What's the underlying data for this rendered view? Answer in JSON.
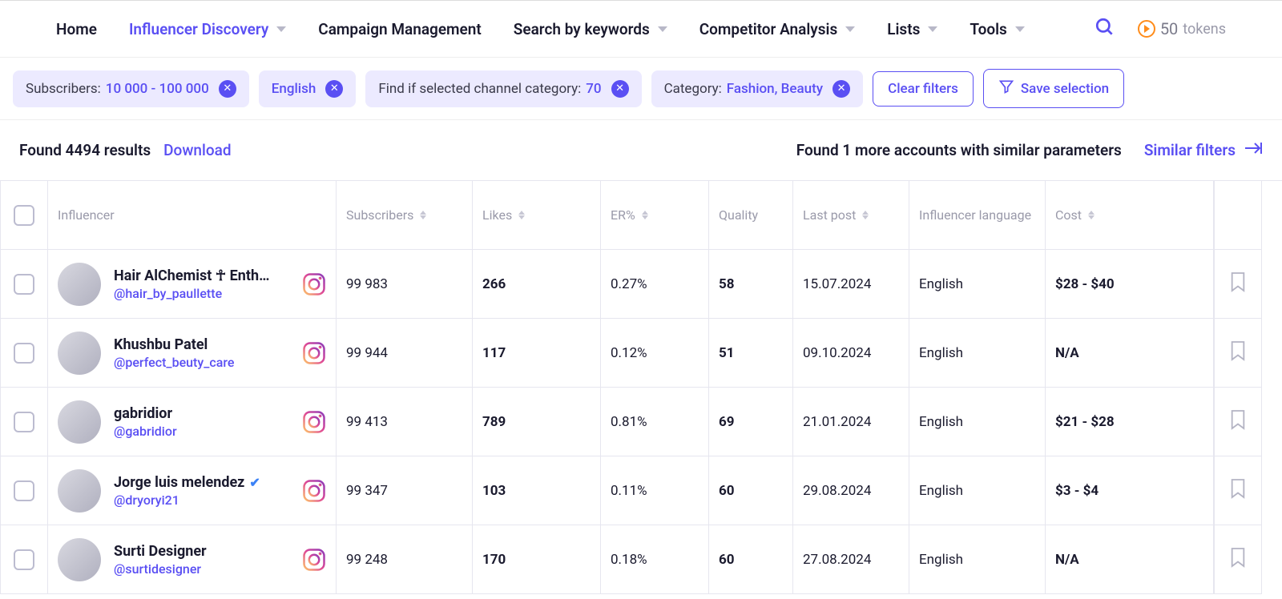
{
  "nav": {
    "home": "Home",
    "discovery": "Influencer Discovery",
    "campaign": "Campaign Management",
    "keywords": "Search by keywords",
    "competitor": "Competitor Analysis",
    "lists": "Lists",
    "tools": "Tools",
    "tokens_count": "50",
    "tokens_label": "tokens"
  },
  "filters": {
    "subscribers_label": "Subscribers:",
    "subscribers_value": "10 000 - 100 000",
    "lang_value": "English",
    "category_find_label": "Find if selected channel category:",
    "category_find_value": "70",
    "category_label": "Category:",
    "category_value": "Fashion, Beauty",
    "clear": "Clear filters",
    "save": "Save selection"
  },
  "meta": {
    "found_label": "Found 4494 results",
    "download": "Download",
    "more_label": "Found 1 more accounts with similar parameters",
    "similar": "Similar filters"
  },
  "columns": {
    "influencer": "Influencer",
    "subscribers": "Subscribers",
    "likes": "Likes",
    "er": "ER%",
    "quality": "Quality",
    "last_post": "Last post",
    "language": "Influencer language",
    "cost": "Cost"
  },
  "rows": [
    {
      "name": "Hair AlChemist ☥ Enth…",
      "handle": "@hair_by_paullette",
      "verified": false,
      "subscribers": "99 983",
      "likes": "266",
      "er": "0.27%",
      "quality": "58",
      "last_post": "15.07.2024",
      "language": "English",
      "cost": "$28 - $40"
    },
    {
      "name": "Khushbu Patel",
      "handle": "@perfect_beuty_care",
      "verified": false,
      "subscribers": "99 944",
      "likes": "117",
      "er": "0.12%",
      "quality": "51",
      "last_post": "09.10.2024",
      "language": "English",
      "cost": "N/A"
    },
    {
      "name": "gabridior",
      "handle": "@gabridior",
      "verified": false,
      "subscribers": "99 413",
      "likes": "789",
      "er": "0.81%",
      "quality": "69",
      "last_post": "21.01.2024",
      "language": "English",
      "cost": "$21 - $28"
    },
    {
      "name": "Jorge luis melendez",
      "handle": "@dryoryi21",
      "verified": true,
      "subscribers": "99 347",
      "likes": "103",
      "er": "0.11%",
      "quality": "60",
      "last_post": "29.08.2024",
      "language": "English",
      "cost": "$3 - $4"
    },
    {
      "name": "Surti Designer",
      "handle": "@surtidesigner",
      "verified": false,
      "subscribers": "99 248",
      "likes": "170",
      "er": "0.18%",
      "quality": "60",
      "last_post": "27.08.2024",
      "language": "English",
      "cost": "N/A"
    }
  ]
}
